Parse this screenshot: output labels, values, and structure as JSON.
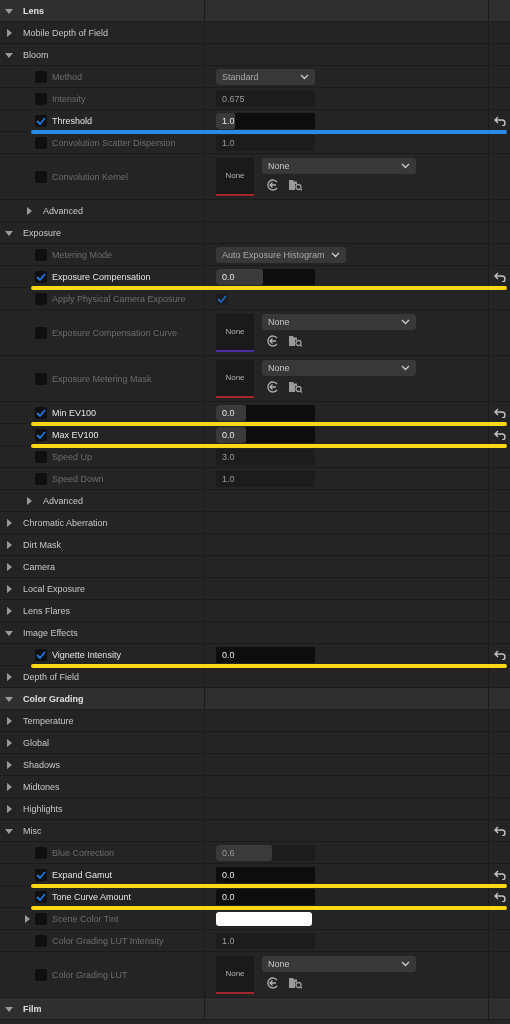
{
  "categories": [
    {
      "kind": "category",
      "title": "Lens",
      "expanded": true,
      "reset": false,
      "children": [
        {
          "kind": "group",
          "title": "Mobile Depth of Field",
          "expanded": false,
          "reset": false
        },
        {
          "kind": "group",
          "title": "Bloom",
          "expanded": true,
          "reset": false,
          "children": [
            {
              "kind": "property",
              "label": "Method",
              "override": false,
              "reset": false,
              "value": {
                "kind": "dropdown",
                "text": "Standard"
              }
            },
            {
              "kind": "property",
              "label": "Intensity",
              "override": false,
              "reset": false,
              "value": {
                "kind": "number",
                "text": "0.675"
              }
            },
            {
              "kind": "property",
              "label": "Threshold",
              "override": true,
              "reset": true,
              "color": "#2a8be6",
              "value": {
                "kind": "number",
                "text": "1.0",
                "level": 0.19
              }
            },
            {
              "kind": "property",
              "label": "Convolution Scatter Dispersion",
              "override": false,
              "reset": false,
              "value": {
                "kind": "number",
                "text": "1.0"
              }
            },
            {
              "kind": "property",
              "label": "Convolution Kernel",
              "override": false,
              "reset": false,
              "value": {
                "kind": "asset",
                "thumb": "None",
                "text": "None",
                "color": "#a3262e"
              }
            },
            {
              "kind": "group",
              "title": "Advanced",
              "expanded": false,
              "reset": false
            }
          ]
        },
        {
          "kind": "group",
          "title": "Exposure",
          "expanded": true,
          "reset": false,
          "children": [
            {
              "kind": "property",
              "label": "Metering Mode",
              "override": false,
              "reset": false,
              "value": {
                "kind": "dropdown",
                "text": "Auto Exposure Histogram"
              }
            },
            {
              "kind": "property",
              "label": "Exposure Compensation",
              "override": true,
              "reset": true,
              "color": "#ffd814",
              "value": {
                "kind": "number",
                "text": "0.0",
                "level": 0.47
              }
            },
            {
              "kind": "property",
              "label": "Apply Physical Camera Exposure",
              "override": false,
              "reset": false,
              "value": {
                "kind": "bool",
                "checked": true
              }
            },
            {
              "kind": "property",
              "label": "Exposure Compensation Curve",
              "override": false,
              "reset": false,
              "value": {
                "kind": "asset",
                "thumb": "None",
                "text": "None",
                "color": "#4a2ea3"
              }
            },
            {
              "kind": "property",
              "label": "Exposure Metering Mask",
              "override": false,
              "reset": false,
              "value": {
                "kind": "asset",
                "thumb": "None",
                "text": "None",
                "color": "#a3262e"
              }
            },
            {
              "kind": "property",
              "label": "Min EV100",
              "override": true,
              "reset": true,
              "color": "#ffd814",
              "value": {
                "kind": "number",
                "text": "0.0",
                "level": 0.3
              }
            },
            {
              "kind": "property",
              "label": "Max EV100",
              "override": true,
              "reset": true,
              "color": "#ffd814",
              "value": {
                "kind": "number",
                "text": "0.0",
                "level": 0.3
              }
            },
            {
              "kind": "property",
              "label": "Speed Up",
              "override": false,
              "reset": false,
              "value": {
                "kind": "number",
                "text": "3.0"
              }
            },
            {
              "kind": "property",
              "label": "Speed Down",
              "override": false,
              "reset": false,
              "value": {
                "kind": "number",
                "text": "1.0"
              }
            },
            {
              "kind": "group",
              "title": "Advanced",
              "expanded": false,
              "reset": false
            }
          ]
        },
        {
          "kind": "group",
          "title": "Chromatic Aberration",
          "expanded": false,
          "reset": false
        },
        {
          "kind": "group",
          "title": "Dirt Mask",
          "expanded": false,
          "reset": false
        },
        {
          "kind": "group",
          "title": "Camera",
          "expanded": false,
          "reset": false
        },
        {
          "kind": "group",
          "title": "Local Exposure",
          "expanded": false,
          "reset": false
        },
        {
          "kind": "group",
          "title": "Lens Flares",
          "expanded": false,
          "reset": false
        },
        {
          "kind": "group",
          "title": "Image Effects",
          "expanded": true,
          "reset": false,
          "children": [
            {
              "kind": "property",
              "label": "Vignette Intensity",
              "override": true,
              "reset": true,
              "color": "#ffd814",
              "value": {
                "kind": "number",
                "text": "0.0"
              }
            }
          ]
        },
        {
          "kind": "group",
          "title": "Depth of Field",
          "expanded": false,
          "reset": false
        }
      ]
    },
    {
      "kind": "category",
      "title": "Color Grading",
      "expanded": true,
      "reset": false,
      "children": [
        {
          "kind": "group",
          "title": "Temperature",
          "expanded": false,
          "reset": false
        },
        {
          "kind": "group",
          "title": "Global",
          "expanded": false,
          "reset": false
        },
        {
          "kind": "group",
          "title": "Shadows",
          "expanded": false,
          "reset": false
        },
        {
          "kind": "group",
          "title": "Midtones",
          "expanded": false,
          "reset": false
        },
        {
          "kind": "group",
          "title": "Highlights",
          "expanded": false,
          "reset": false
        },
        {
          "kind": "group",
          "title": "Misc",
          "expanded": true,
          "reset": true,
          "children": [
            {
              "kind": "property",
              "label": "Blue Correction",
              "override": false,
              "reset": false,
              "value": {
                "kind": "number",
                "text": "0.6",
                "level": 0.57
              }
            },
            {
              "kind": "property",
              "label": "Expand Gamut",
              "override": true,
              "reset": true,
              "color": "#ffd814",
              "value": {
                "kind": "number",
                "text": "0.0"
              }
            },
            {
              "kind": "property",
              "label": "Tone Curve Amount",
              "override": true,
              "reset": true,
              "color": "#ffd814",
              "value": {
                "kind": "number",
                "text": "0.0"
              }
            },
            {
              "kind": "property",
              "label": "Scene Color Tint",
              "override": false,
              "reset": false,
              "expanded": false,
              "value": {
                "kind": "color",
                "color": "#ffffff"
              }
            },
            {
              "kind": "property",
              "label": "Color Grading LUT Intensity",
              "override": false,
              "reset": false,
              "value": {
                "kind": "number",
                "text": "1.0"
              }
            },
            {
              "kind": "property",
              "label": "Color Grading LUT",
              "override": false,
              "reset": false,
              "value": {
                "kind": "asset",
                "thumb": "None",
                "text": "None",
                "color": "#a3262e"
              }
            }
          ]
        }
      ]
    },
    {
      "kind": "category",
      "title": "Film",
      "expanded": true,
      "reset": false
    }
  ]
}
